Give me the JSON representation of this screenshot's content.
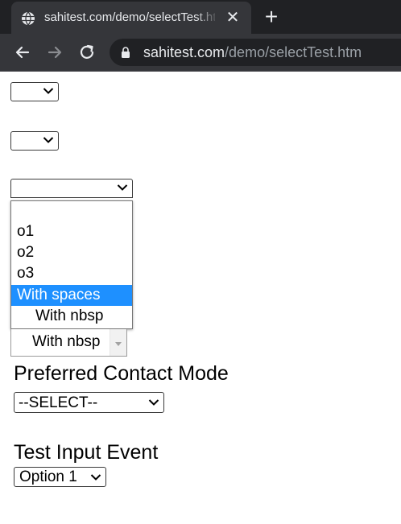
{
  "browser": {
    "tab_title": "sahitest.com/demo/selectTest.htm",
    "new_tab_label": "+",
    "url_host": "sahitest.com",
    "url_path": "/demo/selectTest.htm"
  },
  "page": {
    "select1": {
      "value": ""
    },
    "select2": {
      "value": ""
    },
    "select3": {
      "value": "",
      "options": [
        "",
        "o1",
        "o2",
        "o3",
        "With spaces",
        "With nbsp"
      ],
      "highlighted": "With spaces"
    },
    "listbox_visible_option": "With nbsp",
    "contact": {
      "label": "Preferred Contact Mode",
      "select_value": "--SELECT--"
    },
    "input_event": {
      "label": "Test Input Event",
      "select_value": "Option 1"
    }
  },
  "colors": {
    "tabbar_bg": "#202124",
    "toolbar_bg": "#35363a",
    "highlight": "#1e90ff"
  },
  "icons": [
    "globe-icon",
    "close-icon",
    "plus-icon",
    "back-arrow-icon",
    "forward-arrow-icon",
    "reload-icon",
    "lock-icon",
    "chevron-down-icon",
    "scroll-down-arrow-icon"
  ]
}
